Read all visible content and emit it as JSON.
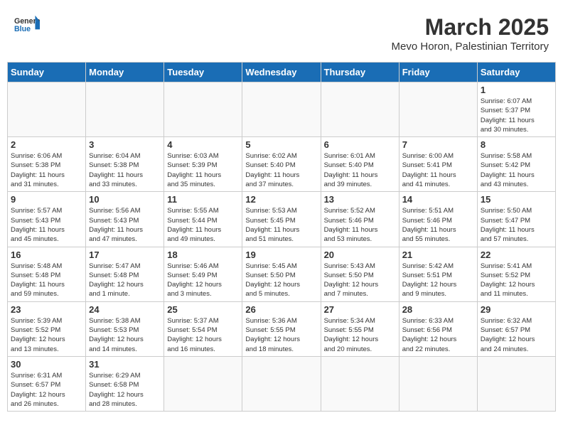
{
  "header": {
    "logo_general": "General",
    "logo_blue": "Blue",
    "month_title": "March 2025",
    "location": "Mevo Horon, Palestinian Territory"
  },
  "days_of_week": [
    "Sunday",
    "Monday",
    "Tuesday",
    "Wednesday",
    "Thursday",
    "Friday",
    "Saturday"
  ],
  "weeks": [
    [
      null,
      null,
      null,
      null,
      null,
      null,
      {
        "day": "1",
        "info": "Sunrise: 6:07 AM\nSunset: 5:37 PM\nDaylight: 11 hours\nand 30 minutes."
      }
    ],
    [
      {
        "day": "2",
        "info": "Sunrise: 6:06 AM\nSunset: 5:38 PM\nDaylight: 11 hours\nand 31 minutes."
      },
      {
        "day": "3",
        "info": "Sunrise: 6:04 AM\nSunset: 5:38 PM\nDaylight: 11 hours\nand 33 minutes."
      },
      {
        "day": "4",
        "info": "Sunrise: 6:03 AM\nSunset: 5:39 PM\nDaylight: 11 hours\nand 35 minutes."
      },
      {
        "day": "5",
        "info": "Sunrise: 6:02 AM\nSunset: 5:40 PM\nDaylight: 11 hours\nand 37 minutes."
      },
      {
        "day": "6",
        "info": "Sunrise: 6:01 AM\nSunset: 5:40 PM\nDaylight: 11 hours\nand 39 minutes."
      },
      {
        "day": "7",
        "info": "Sunrise: 6:00 AM\nSunset: 5:41 PM\nDaylight: 11 hours\nand 41 minutes."
      },
      {
        "day": "8",
        "info": "Sunrise: 5:58 AM\nSunset: 5:42 PM\nDaylight: 11 hours\nand 43 minutes."
      }
    ],
    [
      {
        "day": "9",
        "info": "Sunrise: 5:57 AM\nSunset: 5:43 PM\nDaylight: 11 hours\nand 45 minutes."
      },
      {
        "day": "10",
        "info": "Sunrise: 5:56 AM\nSunset: 5:43 PM\nDaylight: 11 hours\nand 47 minutes."
      },
      {
        "day": "11",
        "info": "Sunrise: 5:55 AM\nSunset: 5:44 PM\nDaylight: 11 hours\nand 49 minutes."
      },
      {
        "day": "12",
        "info": "Sunrise: 5:53 AM\nSunset: 5:45 PM\nDaylight: 11 hours\nand 51 minutes."
      },
      {
        "day": "13",
        "info": "Sunrise: 5:52 AM\nSunset: 5:46 PM\nDaylight: 11 hours\nand 53 minutes."
      },
      {
        "day": "14",
        "info": "Sunrise: 5:51 AM\nSunset: 5:46 PM\nDaylight: 11 hours\nand 55 minutes."
      },
      {
        "day": "15",
        "info": "Sunrise: 5:50 AM\nSunset: 5:47 PM\nDaylight: 11 hours\nand 57 minutes."
      }
    ],
    [
      {
        "day": "16",
        "info": "Sunrise: 5:48 AM\nSunset: 5:48 PM\nDaylight: 11 hours\nand 59 minutes."
      },
      {
        "day": "17",
        "info": "Sunrise: 5:47 AM\nSunset: 5:48 PM\nDaylight: 12 hours\nand 1 minute."
      },
      {
        "day": "18",
        "info": "Sunrise: 5:46 AM\nSunset: 5:49 PM\nDaylight: 12 hours\nand 3 minutes."
      },
      {
        "day": "19",
        "info": "Sunrise: 5:45 AM\nSunset: 5:50 PM\nDaylight: 12 hours\nand 5 minutes."
      },
      {
        "day": "20",
        "info": "Sunrise: 5:43 AM\nSunset: 5:50 PM\nDaylight: 12 hours\nand 7 minutes."
      },
      {
        "day": "21",
        "info": "Sunrise: 5:42 AM\nSunset: 5:51 PM\nDaylight: 12 hours\nand 9 minutes."
      },
      {
        "day": "22",
        "info": "Sunrise: 5:41 AM\nSunset: 5:52 PM\nDaylight: 12 hours\nand 11 minutes."
      }
    ],
    [
      {
        "day": "23",
        "info": "Sunrise: 5:39 AM\nSunset: 5:52 PM\nDaylight: 12 hours\nand 13 minutes."
      },
      {
        "day": "24",
        "info": "Sunrise: 5:38 AM\nSunset: 5:53 PM\nDaylight: 12 hours\nand 14 minutes."
      },
      {
        "day": "25",
        "info": "Sunrise: 5:37 AM\nSunset: 5:54 PM\nDaylight: 12 hours\nand 16 minutes."
      },
      {
        "day": "26",
        "info": "Sunrise: 5:36 AM\nSunset: 5:55 PM\nDaylight: 12 hours\nand 18 minutes."
      },
      {
        "day": "27",
        "info": "Sunrise: 5:34 AM\nSunset: 5:55 PM\nDaylight: 12 hours\nand 20 minutes."
      },
      {
        "day": "28",
        "info": "Sunrise: 6:33 AM\nSunset: 6:56 PM\nDaylight: 12 hours\nand 22 minutes."
      },
      {
        "day": "29",
        "info": "Sunrise: 6:32 AM\nSunset: 6:57 PM\nDaylight: 12 hours\nand 24 minutes."
      }
    ],
    [
      {
        "day": "30",
        "info": "Sunrise: 6:31 AM\nSunset: 6:57 PM\nDaylight: 12 hours\nand 26 minutes."
      },
      {
        "day": "31",
        "info": "Sunrise: 6:29 AM\nSunset: 6:58 PM\nDaylight: 12 hours\nand 28 minutes."
      },
      null,
      null,
      null,
      null,
      null
    ]
  ]
}
